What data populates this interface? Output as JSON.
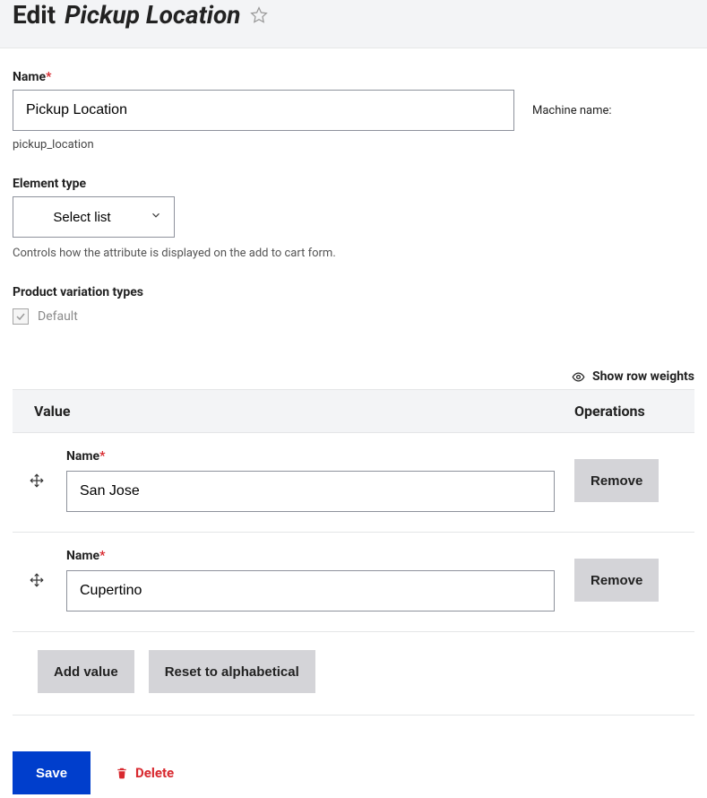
{
  "header": {
    "prefix": "Edit",
    "title": "Pickup Location"
  },
  "name_field": {
    "label": "Name",
    "value": "Pickup Location",
    "machine_label": "Machine name:",
    "machine_value": "pickup_location"
  },
  "element_type": {
    "label": "Element type",
    "value": "Select list",
    "help": "Controls how the attribute is displayed on the add to cart form."
  },
  "variation_types": {
    "label": "Product variation types",
    "options": [
      {
        "label": "Default",
        "checked": true,
        "disabled": true
      }
    ]
  },
  "row_weights_toggle": "Show row weights",
  "table": {
    "headers": {
      "value": "Value",
      "operations": "Operations"
    },
    "row_label": "Name",
    "remove_label": "Remove",
    "rows": [
      {
        "value": "San Jose"
      },
      {
        "value": "Cupertino"
      }
    ]
  },
  "buttons": {
    "add_value": "Add value",
    "reset_alpha": "Reset to alphabetical",
    "save": "Save",
    "delete": "Delete"
  }
}
